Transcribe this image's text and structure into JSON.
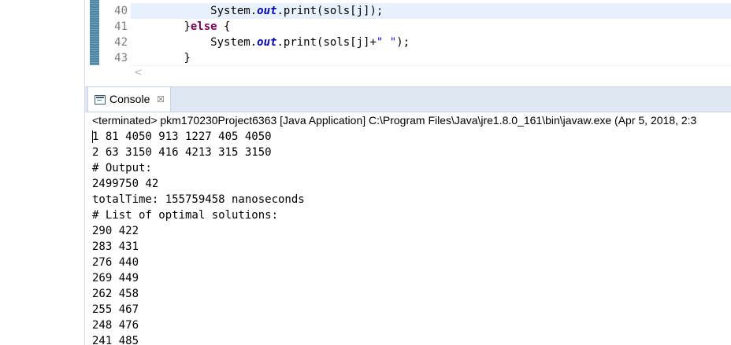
{
  "editor": {
    "lines": [
      {
        "num": "40",
        "indent": "            ",
        "parts": [
          {
            "t": "plain",
            "v": "System."
          },
          {
            "t": "field",
            "v": "out"
          },
          {
            "t": "plain",
            "v": ".print(sols[j]);"
          }
        ]
      },
      {
        "num": "41",
        "indent": "        ",
        "parts": [
          {
            "t": "plain",
            "v": "}"
          },
          {
            "t": "kw",
            "v": "else"
          },
          {
            "t": "plain",
            "v": " {"
          }
        ]
      },
      {
        "num": "42",
        "indent": "            ",
        "parts": [
          {
            "t": "plain",
            "v": "System."
          },
          {
            "t": "field",
            "v": "out"
          },
          {
            "t": "plain",
            "v": ".print(sols[j]+"
          },
          {
            "t": "str",
            "v": "\" \""
          },
          {
            "t": "plain",
            "v": ");"
          }
        ]
      },
      {
        "num": "43",
        "indent": "        ",
        "parts": [
          {
            "t": "plain",
            "v": "}"
          }
        ]
      }
    ],
    "scroll_left_arrow": "<"
  },
  "console_tab": {
    "label": "Console",
    "close_glyph": "☒"
  },
  "console": {
    "status": "<terminated> pkm170230Project6363 [Java Application] C:\\Program Files\\Java\\jre1.8.0_161\\bin\\javaw.exe (Apr 5, 2018, 2:3",
    "output": [
      "1 81 4050 913 1227 405 4050",
      "2 63 3150 416 4213 315 3150",
      "# Output:",
      "2499750 42",
      "totalTime: 155759458 nanoseconds",
      "# List of optimal solutions:",
      "290 422",
      "283 431",
      "276 440",
      "269 449",
      "262 458",
      "255 467",
      "248 476",
      "241 485"
    ]
  }
}
